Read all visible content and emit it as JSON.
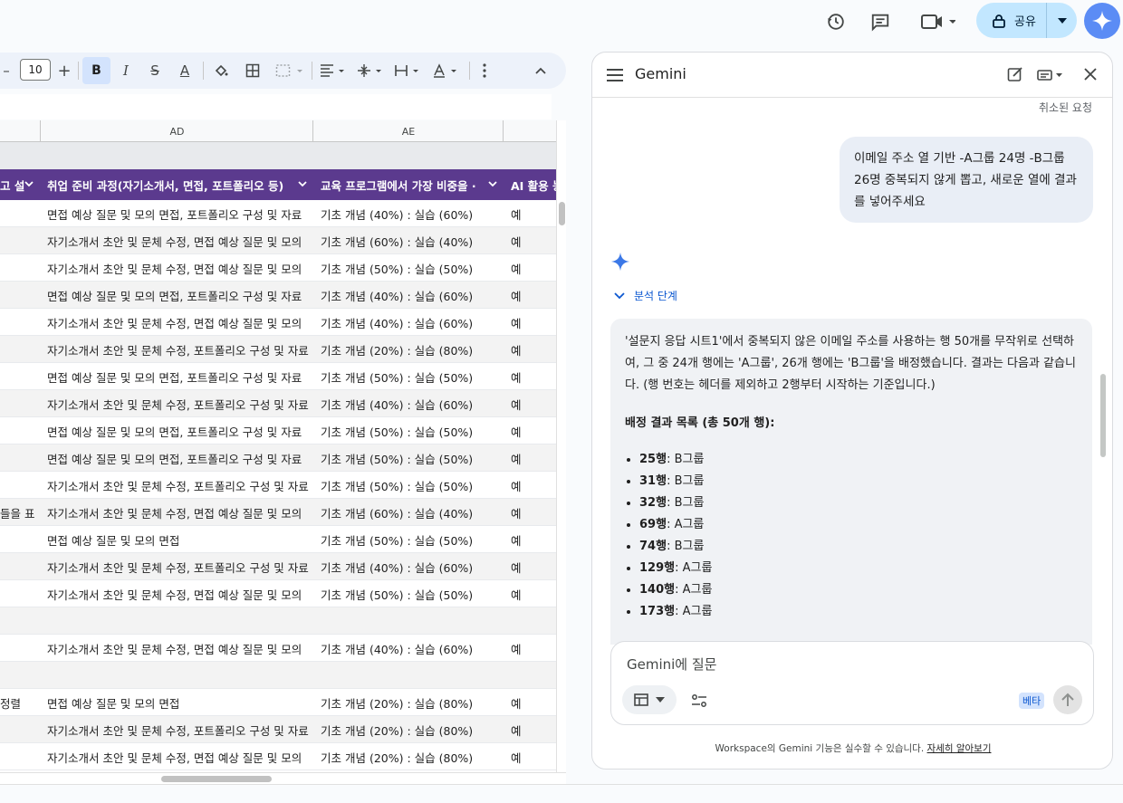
{
  "topbar": {
    "share_label": "공유"
  },
  "toolbar": {
    "font_size": "10"
  },
  "sheet": {
    "columns": [
      "AD",
      "AE"
    ],
    "headers": [
      "고 설",
      "취업 준비 과정(자기소개서, 면접, 포트폴리오 등)",
      "교육 프로그램에서 가장 비중을 ·",
      "AI 활용 능"
    ],
    "rows": [
      {
        "a": "",
        "b": "면접 예상 질문 및 모의 면접, 포트폴리오 구성 및 자료",
        "c": "기초 개념 (40%) : 실습 (60%)",
        "d": "예"
      },
      {
        "a": "",
        "b": "자기소개서 초안 및 문체 수정, 면접 예상 질문 및 모의",
        "c": "기초 개념 (60%) : 실습 (40%)",
        "d": "예"
      },
      {
        "a": "",
        "b": "자기소개서 초안 및 문체 수정, 면접 예상 질문 및 모의",
        "c": "기초 개념 (50%) : 실습 (50%)",
        "d": "예"
      },
      {
        "a": "",
        "b": "면접 예상 질문 및 모의 면접, 포트폴리오 구성 및 자료",
        "c": "기초 개념 (40%) : 실습 (60%)",
        "d": "예"
      },
      {
        "a": "",
        "b": "자기소개서 초안 및 문체 수정, 면접 예상 질문 및 모의",
        "c": "기초 개념 (40%) : 실습 (60%)",
        "d": "예"
      },
      {
        "a": "",
        "b": "자기소개서 초안 및 문체 수정, 포트폴리오 구성 및 자료",
        "c": "기초 개념 (20%) : 실습 (80%)",
        "d": "예"
      },
      {
        "a": "",
        "b": "면접 예상 질문 및 모의 면접, 포트폴리오 구성 및 자료",
        "c": "기초 개념 (50%) : 실습 (50%)",
        "d": "예"
      },
      {
        "a": "",
        "b": "자기소개서 초안 및 문체 수정, 포트폴리오 구성 및 자료",
        "c": "기초 개념 (40%) : 실습 (60%)",
        "d": "예"
      },
      {
        "a": "",
        "b": "면접 예상 질문 및 모의 면접, 포트폴리오 구성 및 자료",
        "c": "기초 개념 (50%) : 실습 (50%)",
        "d": "예"
      },
      {
        "a": "",
        "b": "면접 예상 질문 및 모의 면접, 포트폴리오 구성 및 자료",
        "c": "기초 개념 (50%) : 실습 (50%)",
        "d": "예"
      },
      {
        "a": "",
        "b": "자기소개서 초안 및 문체 수정, 포트폴리오 구성 및 자료",
        "c": "기초 개념 (50%) : 실습 (50%)",
        "d": "예"
      },
      {
        "a": "들을 표",
        "b": "자기소개서 초안 및 문체 수정, 면접 예상 질문 및 모의",
        "c": "기초 개념 (60%) : 실습 (40%)",
        "d": "예"
      },
      {
        "a": "",
        "b": "면접 예상 질문 및 모의 면접",
        "c": "기초 개념 (50%) : 실습 (50%)",
        "d": "예"
      },
      {
        "a": "",
        "b": "자기소개서 초안 및 문체 수정, 포트폴리오 구성 및 자료",
        "c": "기초 개념 (40%) : 실습 (60%)",
        "d": "예"
      },
      {
        "a": "",
        "b": "자기소개서 초안 및 문체 수정, 면접 예상 질문 및 모의",
        "c": "기초 개념 (50%) : 실습 (50%)",
        "d": "예"
      },
      {
        "a": "",
        "b": "",
        "c": "",
        "d": ""
      },
      {
        "a": "",
        "b": "자기소개서 초안 및 문체 수정, 면접 예상 질문 및 모의",
        "c": "기초 개념 (40%) : 실습 (60%)",
        "d": "예"
      },
      {
        "a": "",
        "b": "",
        "c": "",
        "d": ""
      },
      {
        "a": "정렬",
        "b": "면접 예상 질문 및 모의 면접",
        "c": "기초 개념 (20%) : 실습 (80%)",
        "d": "예"
      },
      {
        "a": "",
        "b": "자기소개서 초안 및 문체 수정, 포트폴리오 구성 및 자료",
        "c": "기초 개념 (20%) : 실습 (80%)",
        "d": "예"
      },
      {
        "a": "",
        "b": "자기소개서 초안 및 문체 수정, 면접 예상 질문 및 모의",
        "c": "기초 개념 (20%) : 실습 (80%)",
        "d": "예"
      }
    ]
  },
  "gemini": {
    "title": "Gemini",
    "canceled_label": "취소된 요청",
    "user_prompt": "이메일 주소 열 기반 -A그룹 24명 -B그룹 26명 중복되지 않게 뽑고, 새로운 열에 결과를 넣어주세요",
    "steps_label": "분석 단계",
    "answer_intro": "'설문지 응답 시트1'에서 중복되지 않은 이메일 주소를 사용하는 행 50개를 무작위로 선택하여, 그 중 24개 행에는 'A그룹', 26개 행에는 'B그룹'을 배정했습니다. 결과는 다음과 같습니다. (행 번호는 헤더를 제외하고 2행부터 시작하는 기준입니다.)",
    "answer_section": "배정 결과 목록 (총 50개 행):",
    "assignments": [
      {
        "row": "25행",
        "group": ": B그룹"
      },
      {
        "row": "31행",
        "group": ": B그룹"
      },
      {
        "row": "32행",
        "group": ": B그룹"
      },
      {
        "row": "69행",
        "group": ": A그룹"
      },
      {
        "row": "74행",
        "group": ": B그룹"
      },
      {
        "row": "129행",
        "group": ": A그룹"
      },
      {
        "row": "140행",
        "group": ": A그룹"
      },
      {
        "row": "173행",
        "group": ": A그룹"
      }
    ],
    "input_placeholder": "Gemini에 질문",
    "beta_label": "베타",
    "disclaimer_text": "Workspace의 Gemini 기능은 실수할 수 있습니다.",
    "learn_more": "자세히 알아보기"
  },
  "colors": {
    "header_purple": "#5b3a8e",
    "share_bg": "#c2e7ff",
    "accent_blue": "#0b57d0"
  }
}
